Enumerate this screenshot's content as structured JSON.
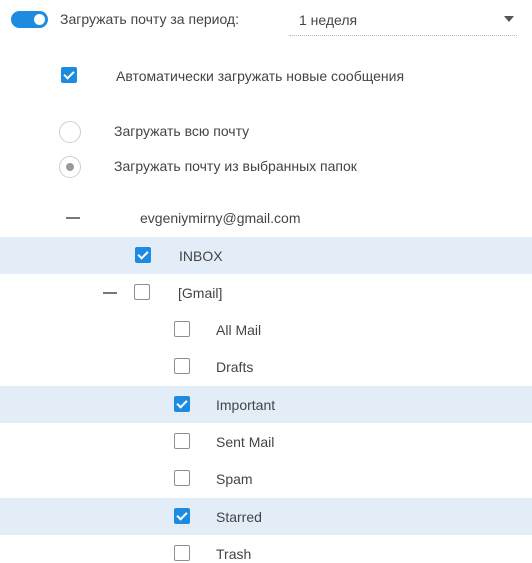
{
  "period": {
    "toggle_on": true,
    "label": "Загружать почту за период:",
    "value": "1 неделя"
  },
  "auto_load": {
    "label": "Автоматически загружать новые сообщения",
    "checked": true
  },
  "load_mode": {
    "all_label": "Загружать всю почту",
    "selected_label": "Загружать почту из выбранных папок",
    "selected": "selected_folders"
  },
  "account": {
    "email": "evgeniymirny@gmail.com"
  },
  "folders": {
    "inbox": "INBOX",
    "gmail": "[Gmail]",
    "children": [
      "All Mail",
      "Drafts",
      "Important",
      "Sent Mail",
      "Spam",
      "Starred",
      "Trash"
    ]
  },
  "colors": {
    "accent": "#1d8ce0",
    "highlight": "#e3edf8"
  }
}
